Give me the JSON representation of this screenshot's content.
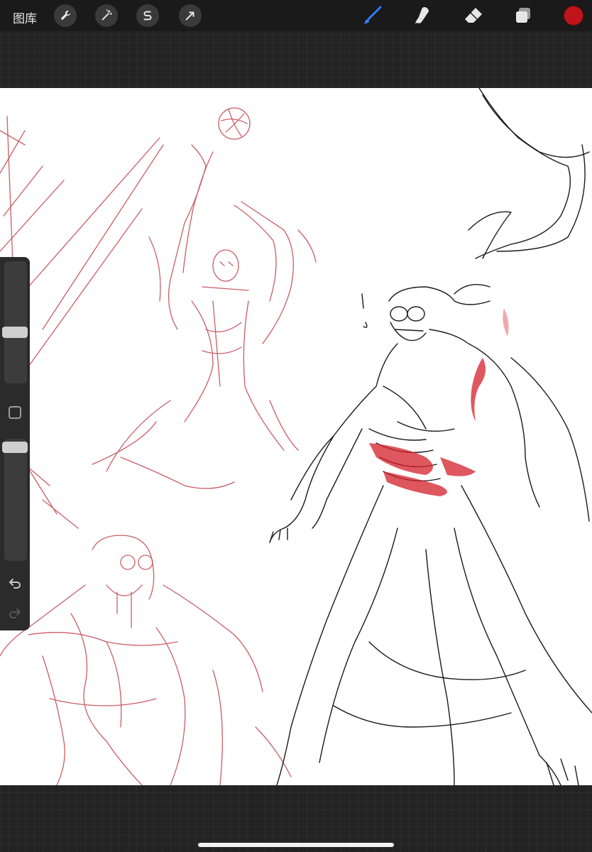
{
  "app": {
    "gallery_label": "图库"
  },
  "toolbar": {
    "left_tools": [
      {
        "icon": "wrench-icon",
        "name": "actions"
      },
      {
        "icon": "magic-wand-icon",
        "name": "adjustments"
      },
      {
        "icon": "selection-s-icon",
        "name": "selection"
      },
      {
        "icon": "arrow-cursor-icon",
        "name": "transform"
      }
    ],
    "right_tools": [
      {
        "icon": "brush-icon",
        "name": "paint",
        "active": true
      },
      {
        "icon": "smudge-icon",
        "name": "smudge"
      },
      {
        "icon": "eraser-icon",
        "name": "eraser"
      },
      {
        "icon": "layers-icon",
        "name": "layers"
      }
    ],
    "current_color": "#c0141b"
  },
  "sidebar": {
    "brush_size_level": 0.33,
    "opacity_level": 0.0,
    "modify_icon": "square-modify-icon",
    "undo_icon": "undo-icon",
    "redo_icon": "redo-icon"
  },
  "colors": {
    "toolbar_bg": "#1a1a1a",
    "canvas_bg": "#ffffff",
    "sketch_red": "#c0424a",
    "ink_black": "#1a1a1a",
    "active_tool_blue": "#2f7df6"
  }
}
